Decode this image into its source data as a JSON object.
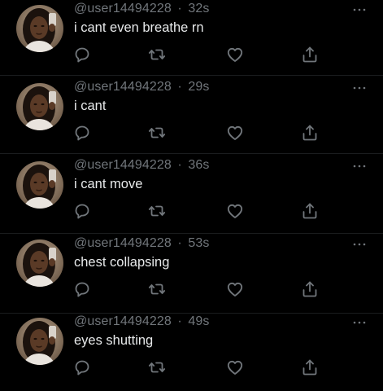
{
  "feed": {
    "tweets": [
      {
        "handle": "@user14494228",
        "separator": "·",
        "time": "32s",
        "text": "i cant even breathe rn"
      },
      {
        "handle": "@user14494228",
        "separator": "·",
        "time": "29s",
        "text": "i cant"
      },
      {
        "handle": "@user14494228",
        "separator": "·",
        "time": "36s",
        "text": "i cant move"
      },
      {
        "handle": "@user14494228",
        "separator": "·",
        "time": "53s",
        "text": "chest collapsing"
      },
      {
        "handle": "@user14494228",
        "separator": "·",
        "time": "49s",
        "text": "eyes shutting"
      }
    ],
    "icons": {
      "more": "more-horizontal-icon",
      "reply": "reply-icon",
      "retweet": "retweet-icon",
      "like": "heart-icon",
      "share": "share-icon"
    },
    "colors": {
      "background": "#000000",
      "text": "#e7e9ea",
      "secondary": "#71767b",
      "divider": "#2f3336"
    }
  }
}
